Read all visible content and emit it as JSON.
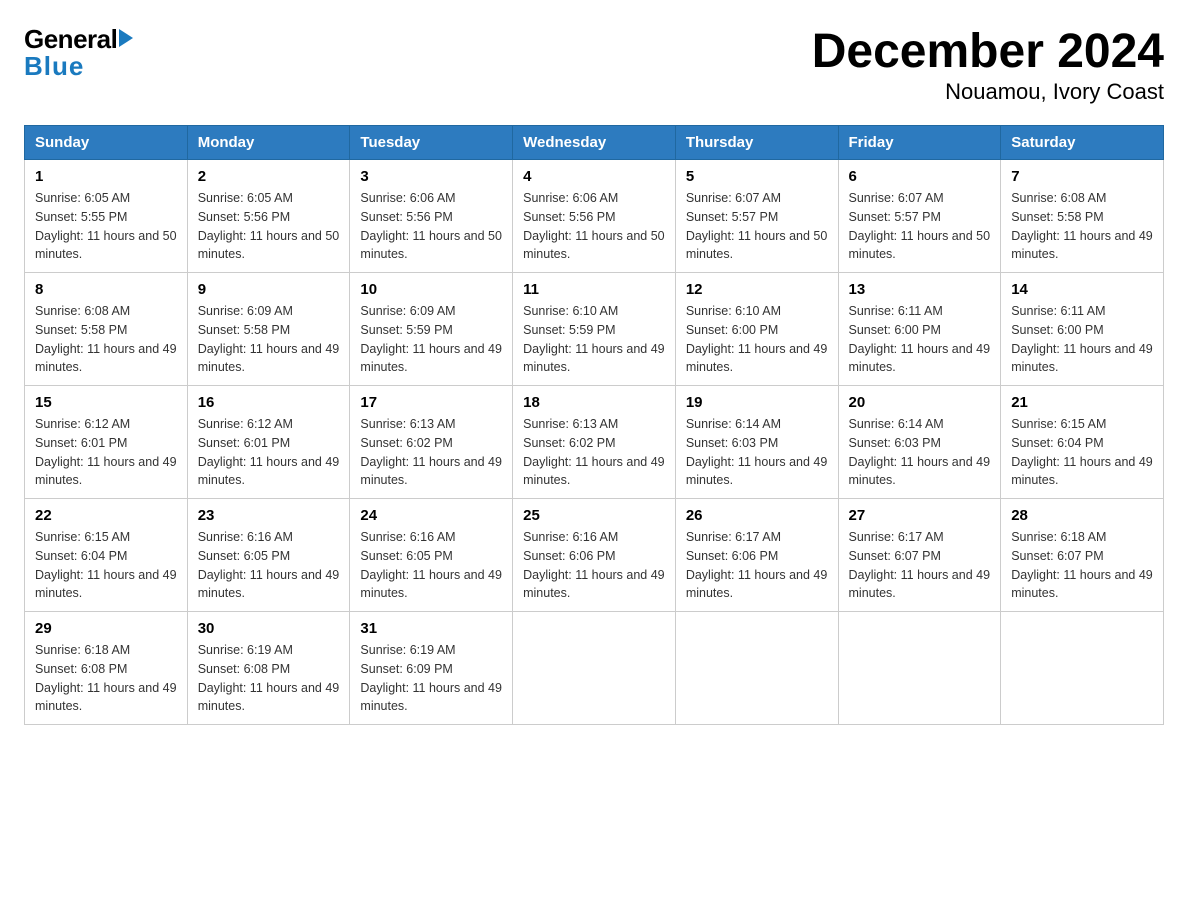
{
  "header": {
    "logo_general": "General",
    "logo_blue": "Blue",
    "title": "December 2024",
    "subtitle": "Nouamou, Ivory Coast"
  },
  "days_of_week": [
    "Sunday",
    "Monday",
    "Tuesday",
    "Wednesday",
    "Thursday",
    "Friday",
    "Saturday"
  ],
  "weeks": [
    [
      {
        "day": "1",
        "sunrise": "6:05 AM",
        "sunset": "5:55 PM",
        "daylight": "11 hours and 50 minutes."
      },
      {
        "day": "2",
        "sunrise": "6:05 AM",
        "sunset": "5:56 PM",
        "daylight": "11 hours and 50 minutes."
      },
      {
        "day": "3",
        "sunrise": "6:06 AM",
        "sunset": "5:56 PM",
        "daylight": "11 hours and 50 minutes."
      },
      {
        "day": "4",
        "sunrise": "6:06 AM",
        "sunset": "5:56 PM",
        "daylight": "11 hours and 50 minutes."
      },
      {
        "day": "5",
        "sunrise": "6:07 AM",
        "sunset": "5:57 PM",
        "daylight": "11 hours and 50 minutes."
      },
      {
        "day": "6",
        "sunrise": "6:07 AM",
        "sunset": "5:57 PM",
        "daylight": "11 hours and 50 minutes."
      },
      {
        "day": "7",
        "sunrise": "6:08 AM",
        "sunset": "5:58 PM",
        "daylight": "11 hours and 49 minutes."
      }
    ],
    [
      {
        "day": "8",
        "sunrise": "6:08 AM",
        "sunset": "5:58 PM",
        "daylight": "11 hours and 49 minutes."
      },
      {
        "day": "9",
        "sunrise": "6:09 AM",
        "sunset": "5:58 PM",
        "daylight": "11 hours and 49 minutes."
      },
      {
        "day": "10",
        "sunrise": "6:09 AM",
        "sunset": "5:59 PM",
        "daylight": "11 hours and 49 minutes."
      },
      {
        "day": "11",
        "sunrise": "6:10 AM",
        "sunset": "5:59 PM",
        "daylight": "11 hours and 49 minutes."
      },
      {
        "day": "12",
        "sunrise": "6:10 AM",
        "sunset": "6:00 PM",
        "daylight": "11 hours and 49 minutes."
      },
      {
        "day": "13",
        "sunrise": "6:11 AM",
        "sunset": "6:00 PM",
        "daylight": "11 hours and 49 minutes."
      },
      {
        "day": "14",
        "sunrise": "6:11 AM",
        "sunset": "6:00 PM",
        "daylight": "11 hours and 49 minutes."
      }
    ],
    [
      {
        "day": "15",
        "sunrise": "6:12 AM",
        "sunset": "6:01 PM",
        "daylight": "11 hours and 49 minutes."
      },
      {
        "day": "16",
        "sunrise": "6:12 AM",
        "sunset": "6:01 PM",
        "daylight": "11 hours and 49 minutes."
      },
      {
        "day": "17",
        "sunrise": "6:13 AM",
        "sunset": "6:02 PM",
        "daylight": "11 hours and 49 minutes."
      },
      {
        "day": "18",
        "sunrise": "6:13 AM",
        "sunset": "6:02 PM",
        "daylight": "11 hours and 49 minutes."
      },
      {
        "day": "19",
        "sunrise": "6:14 AM",
        "sunset": "6:03 PM",
        "daylight": "11 hours and 49 minutes."
      },
      {
        "day": "20",
        "sunrise": "6:14 AM",
        "sunset": "6:03 PM",
        "daylight": "11 hours and 49 minutes."
      },
      {
        "day": "21",
        "sunrise": "6:15 AM",
        "sunset": "6:04 PM",
        "daylight": "11 hours and 49 minutes."
      }
    ],
    [
      {
        "day": "22",
        "sunrise": "6:15 AM",
        "sunset": "6:04 PM",
        "daylight": "11 hours and 49 minutes."
      },
      {
        "day": "23",
        "sunrise": "6:16 AM",
        "sunset": "6:05 PM",
        "daylight": "11 hours and 49 minutes."
      },
      {
        "day": "24",
        "sunrise": "6:16 AM",
        "sunset": "6:05 PM",
        "daylight": "11 hours and 49 minutes."
      },
      {
        "day": "25",
        "sunrise": "6:16 AM",
        "sunset": "6:06 PM",
        "daylight": "11 hours and 49 minutes."
      },
      {
        "day": "26",
        "sunrise": "6:17 AM",
        "sunset": "6:06 PM",
        "daylight": "11 hours and 49 minutes."
      },
      {
        "day": "27",
        "sunrise": "6:17 AM",
        "sunset": "6:07 PM",
        "daylight": "11 hours and 49 minutes."
      },
      {
        "day": "28",
        "sunrise": "6:18 AM",
        "sunset": "6:07 PM",
        "daylight": "11 hours and 49 minutes."
      }
    ],
    [
      {
        "day": "29",
        "sunrise": "6:18 AM",
        "sunset": "6:08 PM",
        "daylight": "11 hours and 49 minutes."
      },
      {
        "day": "30",
        "sunrise": "6:19 AM",
        "sunset": "6:08 PM",
        "daylight": "11 hours and 49 minutes."
      },
      {
        "day": "31",
        "sunrise": "6:19 AM",
        "sunset": "6:09 PM",
        "daylight": "11 hours and 49 minutes."
      },
      null,
      null,
      null,
      null
    ]
  ],
  "labels": {
    "sunrise": "Sunrise:",
    "sunset": "Sunset:",
    "daylight": "Daylight:"
  }
}
